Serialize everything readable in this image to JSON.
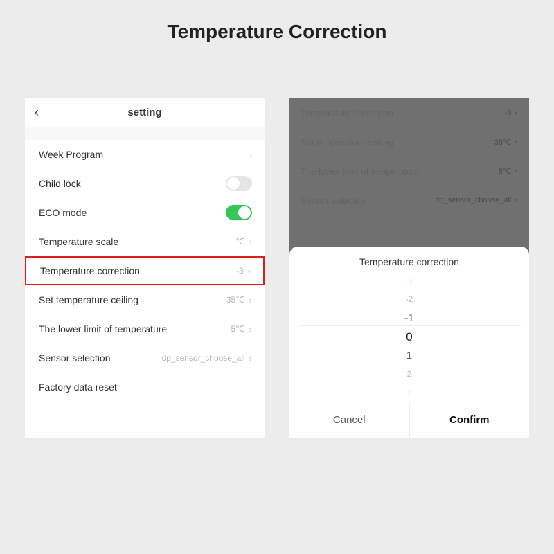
{
  "page_title": "Temperature Correction",
  "left": {
    "header": "setting",
    "rows": {
      "week_program": {
        "label": "Week Program"
      },
      "child_lock": {
        "label": "Child lock",
        "on": false
      },
      "eco_mode": {
        "label": "ECO mode",
        "on": true
      },
      "temp_scale": {
        "label": "Temperature scale",
        "value": "℃"
      },
      "temp_corr": {
        "label": "Temperature correction",
        "value": "-3"
      },
      "ceiling": {
        "label": "Set temperature ceiling",
        "value": "35℃"
      },
      "floor": {
        "label": "The lower limit of temperature",
        "value": "5℃"
      },
      "sensor": {
        "label": "Sensor selection",
        "value": "dp_sensor_choose_all"
      },
      "factory": {
        "label": "Factory data reset"
      }
    }
  },
  "right": {
    "bg_rows": [
      {
        "label": "Temperature correction",
        "value": "-3"
      },
      {
        "label": "Set temperature ceiling",
        "value": "35℃"
      },
      {
        "label": "The lower limit of temperature",
        "value": "5℃"
      },
      {
        "label": "Sensor selection",
        "value": "dp_sensor_choose_all"
      }
    ],
    "sheet": {
      "title": "Temperature correction",
      "options": [
        "-3",
        "-2",
        "-1",
        "0",
        "1",
        "2",
        "3"
      ],
      "cancel": "Cancel",
      "confirm": "Confirm"
    }
  }
}
